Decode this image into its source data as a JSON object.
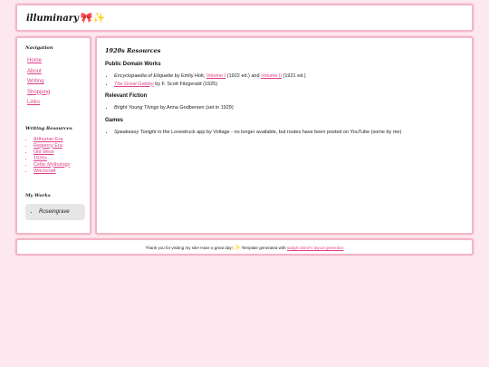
{
  "header": {
    "title": "illuminary",
    "decor": "🎀✨"
  },
  "sidebar": {
    "nav_heading": "Navigation",
    "nav_items": [
      "Home",
      "About",
      "Writing",
      "Shopping",
      "Links"
    ],
    "resources_heading": "Writing Resources",
    "resources": [
      "Arthurian Era",
      "Regency Era",
      "Old West",
      "1920s",
      "Celtic Mythology",
      "Witchcraft"
    ],
    "works_heading": "My Works",
    "works": [
      "Roseingrave"
    ]
  },
  "main": {
    "page_title": "1920s Resources",
    "sections": {
      "public_domain": {
        "heading": "Public Domain Works",
        "item1": {
          "title": "Encyclopaedia of Etiquette",
          "by": " by Emily Holt, ",
          "vol1": "Volume I",
          "mid": " (1922 ed.) and ",
          "vol2": "Volume II",
          "end": " (1921 ed.)"
        },
        "item2": {
          "title": "The Great Gatsby",
          "rest": " by F. Scott Fitzgerald (1925)"
        }
      },
      "fiction": {
        "heading": "Relevant Fiction",
        "item1": {
          "title": "Bright Young Things",
          "rest": " by Anna Godbersen (set in 1929)"
        }
      },
      "games": {
        "heading": "Games",
        "item1": {
          "title": "Speakeasy Tonight",
          "rest": " in the Lovestruck app by Voltage - no longer available, but routes have been posted on YouTube (some by me)"
        }
      }
    }
  },
  "footer": {
    "text_before": "Thank you for visiting my site! Have a great day! ",
    "sparkle": "✨",
    "text_after": " Template generated with ",
    "link": "sadgrl.online's layout generator"
  },
  "colors": {
    "background": "#fde8ef",
    "border": "#f4b6c8",
    "link": "#e0408a"
  }
}
